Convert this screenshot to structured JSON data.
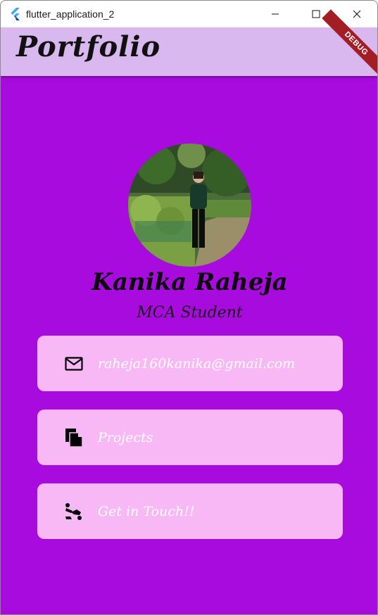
{
  "window": {
    "title": "flutter_application_2",
    "controls": [
      "minimize-icon",
      "maximize-icon",
      "close-icon"
    ]
  },
  "appbar": {
    "title": "Portfolio",
    "debug_banner": "DEBUG"
  },
  "profile": {
    "name": "Kanika Raheja",
    "subtitle": "MCA Student"
  },
  "cards": [
    {
      "icon": "mail-icon",
      "label": "raheja160kanika@gmail.com"
    },
    {
      "icon": "files-icon",
      "label": "Projects"
    },
    {
      "icon": "handshake-icon",
      "label": "Get in Touch!!"
    }
  ],
  "colors": {
    "background": "#a80bde",
    "appbar": "#d9b8f0",
    "card": "#f8b8f6",
    "debug_banner": "#a31d24"
  }
}
